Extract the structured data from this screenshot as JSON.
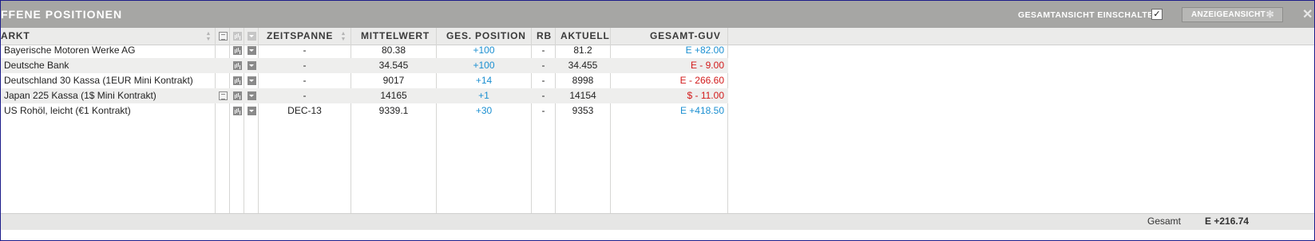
{
  "window": {
    "title": "FFENE POSITIONEN",
    "toggle_label": "GESAMTANSICHT EINSCHALTEN",
    "toggle_checked": "✓",
    "view_button_label": "ANZEIGEANSICHT",
    "close_glyph": "✕"
  },
  "columns": {
    "markt": "ARKT",
    "zeitspanne": "ZEITSPANNE",
    "mittelwert": "MITTELWERT",
    "ges_position": "GES. POSITION",
    "rb": "RB",
    "aktuell": "AKTUELL",
    "gesamt_guv": "GESAMT-GUV"
  },
  "rows": [
    {
      "markt": "Bayerische Motoren Werke AG",
      "has_doc": false,
      "zeitspanne": "-",
      "mittelwert": "80.38",
      "position": "+100",
      "rb": "-",
      "aktuell": "81.2",
      "guv": "E +82.00",
      "guv_color": "blue"
    },
    {
      "markt": "Deutsche Bank",
      "has_doc": false,
      "zeitspanne": "-",
      "mittelwert": "34.545",
      "position": "+100",
      "rb": "-",
      "aktuell": "34.455",
      "guv": "E - 9.00",
      "guv_color": "red"
    },
    {
      "markt": "Deutschland 30 Kassa (1EUR Mini Kontrakt)",
      "has_doc": false,
      "zeitspanne": "-",
      "mittelwert": "9017",
      "position": "+14",
      "rb": "-",
      "aktuell": "8998",
      "guv": "E - 266.60",
      "guv_color": "red"
    },
    {
      "markt": "Japan 225 Kassa (1$ Mini Kontrakt)",
      "has_doc": true,
      "zeitspanne": "-",
      "mittelwert": "14165",
      "position": "+1",
      "rb": "-",
      "aktuell": "14154",
      "guv": "$ - 11.00",
      "guv_color": "red"
    },
    {
      "markt": "US Rohöl, leicht (€1 Kontrakt)",
      "has_doc": false,
      "zeitspanne": "DEC-13",
      "mittelwert": "9339.1",
      "position": "+30",
      "rb": "-",
      "aktuell": "9353",
      "guv": "E +418.50",
      "guv_color": "blue"
    }
  ],
  "footer": {
    "label": "Gesamt",
    "value": "E +216.74"
  },
  "colors": {
    "positive": "#1b8fd1",
    "negative": "#d21a1a",
    "titlebar": "#a6a6a4"
  }
}
